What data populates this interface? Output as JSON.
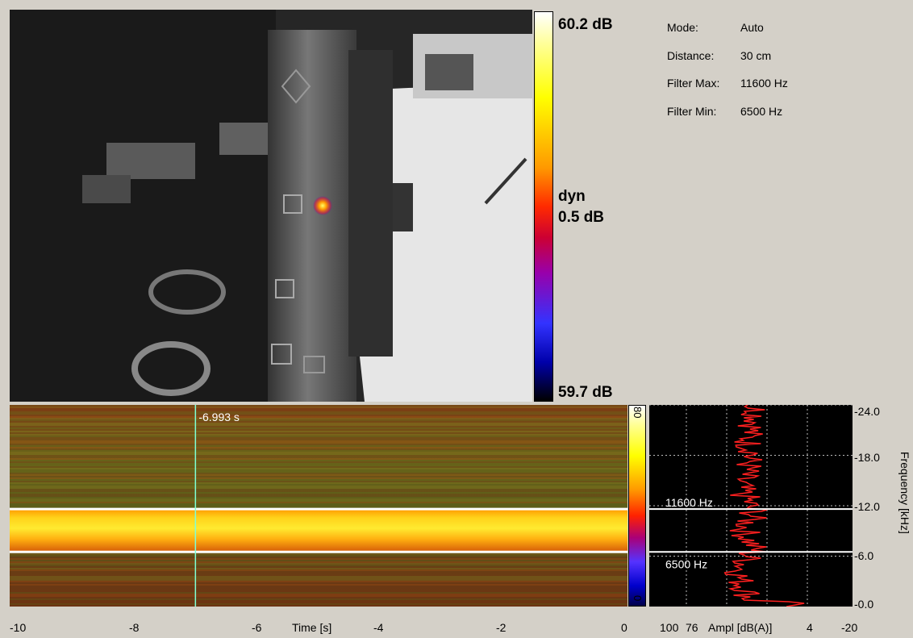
{
  "colorbar": {
    "max_label": "60.2 dB",
    "dyn_label": "dyn",
    "dyn_value": "0.5 dB",
    "min_label": "59.7 dB"
  },
  "info": {
    "mode_key": "Mode:",
    "mode_val": "Auto",
    "distance_key": "Distance:",
    "distance_val": "30 cm",
    "fmax_key": "Filter Max:",
    "fmax_val": "11600 Hz",
    "fmin_key": "Filter Min:",
    "fmin_val": "6500 Hz"
  },
  "spectrogram": {
    "cursor_label": "-6.993 s",
    "cursor_time": -6.993,
    "x_ticks": [
      "-10",
      "-8",
      "-6",
      "-4",
      "-2",
      "0"
    ],
    "x_label": "Time [s]",
    "cb_top": "80",
    "cb_bottom": "0",
    "time_range": [
      -10,
      0
    ],
    "freq_range_khz": [
      0,
      24
    ],
    "filter_max_khz": 11.6,
    "filter_min_khz": 6.5
  },
  "spectrum": {
    "marker_max": "11600 Hz",
    "marker_min": "6500 Hz",
    "y_ticks": [
      "-24.0",
      "-18.0",
      "-12.0",
      "-6.0",
      "-0.0"
    ],
    "y_label": "Frequency [kHz]",
    "x_ticks": [
      "100",
      "76",
      "4",
      "-20"
    ],
    "x_label": "Ampl [dB(A)]"
  },
  "colors": {
    "cursor": "#7fffd4",
    "filter_line": "#ffffff",
    "spectrum_line": "#ff2020",
    "spectrum_bg": "#000000",
    "grid": "#bbbbbb"
  }
}
